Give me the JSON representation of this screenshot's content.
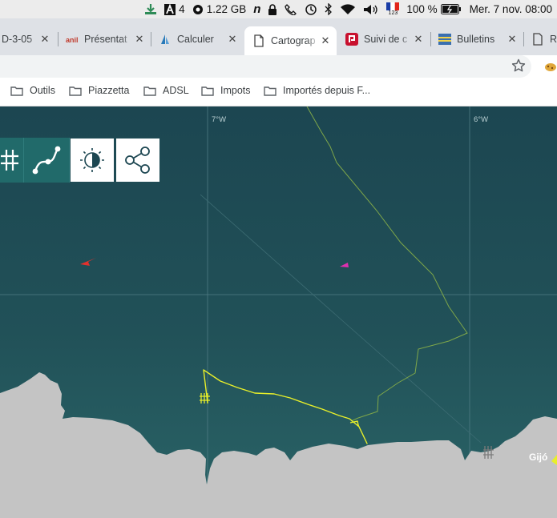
{
  "menubar": {
    "adobe_count": "4",
    "memory": "1.22 GB",
    "input_source": "123",
    "battery": "100 %",
    "clock": "Mer. 7 nov.  08:00"
  },
  "tabs": [
    {
      "title": "D-3-05",
      "active": false
    },
    {
      "title": "Présentat",
      "active": false
    },
    {
      "title": "Calculer",
      "active": false
    },
    {
      "title": "Cartograp",
      "active": true
    },
    {
      "title": "Suivi de c",
      "active": false
    },
    {
      "title": "Bulletins",
      "active": false
    },
    {
      "title": "Re",
      "active": false
    }
  ],
  "bookmarks": [
    "Outils",
    "Piazzetta",
    "ADSL",
    "Impots",
    "Importés depuis F..."
  ],
  "map": {
    "lon_labels": [
      "7°W",
      "6°W"
    ],
    "place_label": "Gijó",
    "colors": {
      "sea": "#1f4c55",
      "land": "#c4c4c4",
      "track": "#e8ef2a",
      "route": "#7fa74a",
      "boat_red": "#e3312d",
      "boat_magenta": "#e02fb0"
    },
    "toolbar": [
      "grid-icon",
      "route-icon",
      "contrast-icon",
      "share-icon"
    ]
  }
}
